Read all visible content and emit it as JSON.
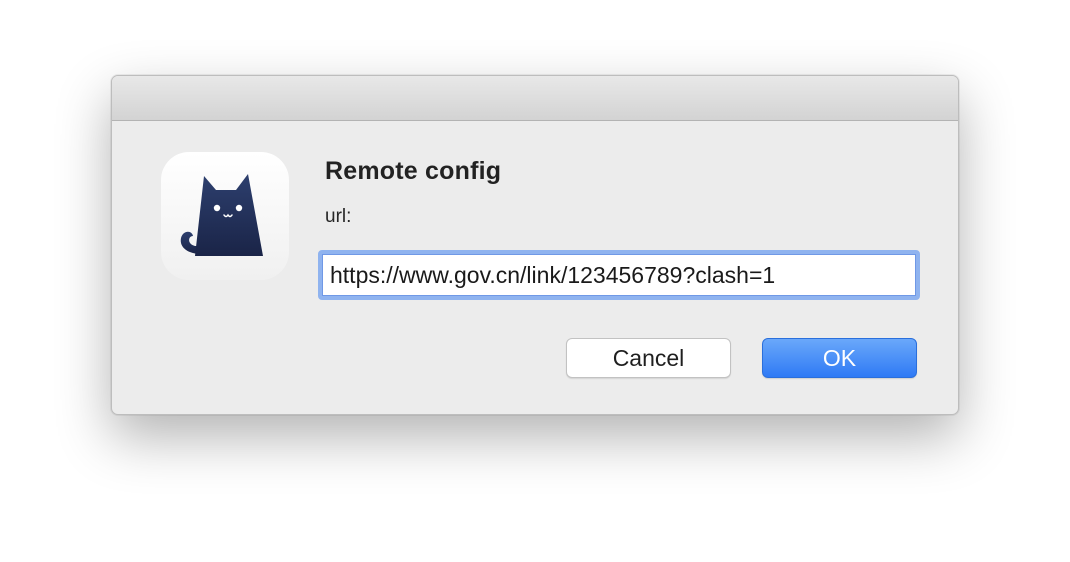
{
  "dialog": {
    "title": "Remote config",
    "field_label": "url:",
    "url_value": "https://www.gov.cn/link/123456789?clash=1",
    "cancel_label": "Cancel",
    "ok_label": "OK",
    "app_icon": "clash-cat-icon"
  },
  "colors": {
    "dialog_background": "#ececec",
    "input_focus_ring": "#8fb3ef",
    "ok_button": "#2f7af5",
    "icon_cat": "#1f2d55"
  }
}
